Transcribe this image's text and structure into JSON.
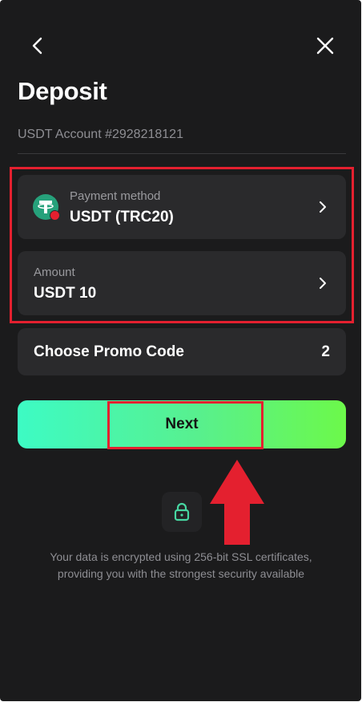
{
  "header": {
    "back_icon": "chevron-left-icon",
    "close_icon": "close-icon",
    "title": "Deposit"
  },
  "account": {
    "label": "USDT Account #2928218121"
  },
  "payment_method": {
    "label": "Payment method",
    "value": "USDT (TRC20)",
    "icon": "tether-coin-icon"
  },
  "amount": {
    "label": "Amount",
    "value": "USDT 10"
  },
  "promo": {
    "label": "Choose Promo Code",
    "count": "2"
  },
  "next_button": {
    "label": "Next"
  },
  "security": {
    "icon": "lock-icon",
    "line1": "Your data is encrypted using 256-bit SSL certificates,",
    "line2": "providing you with the strongest security available"
  },
  "colors": {
    "background": "#1b1b1c",
    "card": "#2a2a2c",
    "accent_start": "#3dfbc4",
    "accent_end": "#6cf94a",
    "annotation": "#e4202f",
    "tether": "#26a17b"
  }
}
